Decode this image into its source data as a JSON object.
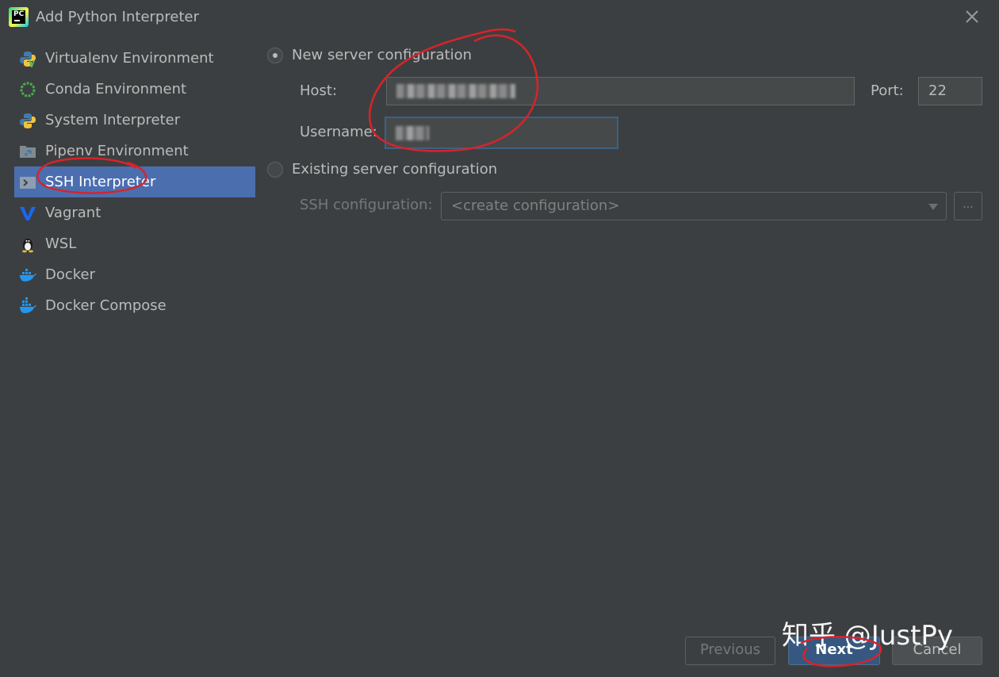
{
  "window": {
    "title": "Add Python Interpreter",
    "app_icon_text": "PC"
  },
  "sidebar": {
    "items": [
      {
        "label": "Virtualenv Environment",
        "icon": "python-virtualenv-icon"
      },
      {
        "label": "Conda Environment",
        "icon": "conda-icon"
      },
      {
        "label": "System Interpreter",
        "icon": "python-icon"
      },
      {
        "label": "Pipenv Environment",
        "icon": "pipenv-folder-icon"
      },
      {
        "label": "SSH Interpreter",
        "icon": "ssh-terminal-icon",
        "selected": true
      },
      {
        "label": "Vagrant",
        "icon": "vagrant-icon"
      },
      {
        "label": "WSL",
        "icon": "linux-penguin-icon"
      },
      {
        "label": "Docker",
        "icon": "docker-icon"
      },
      {
        "label": "Docker Compose",
        "icon": "docker-compose-icon"
      }
    ]
  },
  "new_server": {
    "radio_label": "New server configuration",
    "selected": true,
    "host_label": "Host:",
    "port_label": "Port:",
    "port_value": "22",
    "username_label": "Username:"
  },
  "existing_server": {
    "radio_label": "Existing server configuration",
    "selected": false,
    "ssh_config_label": "SSH configuration:",
    "ssh_config_value": "<create configuration>",
    "browse_label": "..."
  },
  "buttons": {
    "previous": "Previous",
    "next": "Next",
    "cancel": "Cancel"
  },
  "watermark": "知乎 @JustPy",
  "colors": {
    "background": "#3c3f41",
    "selection": "#4b6eaf",
    "primary_button": "#365880",
    "annotation": "#d8232a"
  }
}
